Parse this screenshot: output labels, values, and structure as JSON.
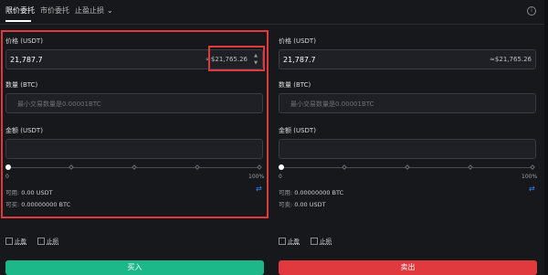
{
  "tabs": [
    {
      "label": "限价委托"
    },
    {
      "label": "市价委托"
    },
    {
      "label": "止盈止损"
    }
  ],
  "icons": {
    "info": "info-icon",
    "chevron": "chevron-down-icon",
    "swap": "swap-icon",
    "stepper": "stepper-icon"
  },
  "buy_panel": {
    "price_label": "价格 (USDT)",
    "price_value": "21,787.7",
    "price_approx": "≈$21,765.26",
    "qty_label": "数量 (BTC)",
    "qty_placeholder": "最小交易数量是0.00001BTC",
    "total_label": "金额 (USDT)",
    "slider_min": "0",
    "slider_max": "100%",
    "slider_progress": 0,
    "available_label": "可用:",
    "available_value": "0.00 USDT",
    "buyable_label": "可买:",
    "buyable_value": "0.00000000 BTC",
    "button_label": "买入"
  },
  "sell_panel": {
    "price_label": "价格 (USDT)",
    "price_value": "21,787.7",
    "price_approx": "≈$21,765.26",
    "qty_label": "数量 (BTC)",
    "qty_placeholder": "最小交易数量是0.00001BTC",
    "total_label": "金额 (USDT)",
    "slider_min": "0",
    "slider_max": "100%",
    "slider_progress": 0,
    "available_label": "可用:",
    "available_value": "0.00000000 BTC",
    "sellable_label": "可卖:",
    "sellable_value": "0.00 USDT",
    "button_label": "卖出"
  },
  "options": {
    "take_profit": "止盈",
    "stop_loss": "止损"
  },
  "colors": {
    "buy": "#1db88a",
    "sell": "#e0393e",
    "highlight": "#e0393e",
    "accent": "#3b82f6"
  }
}
